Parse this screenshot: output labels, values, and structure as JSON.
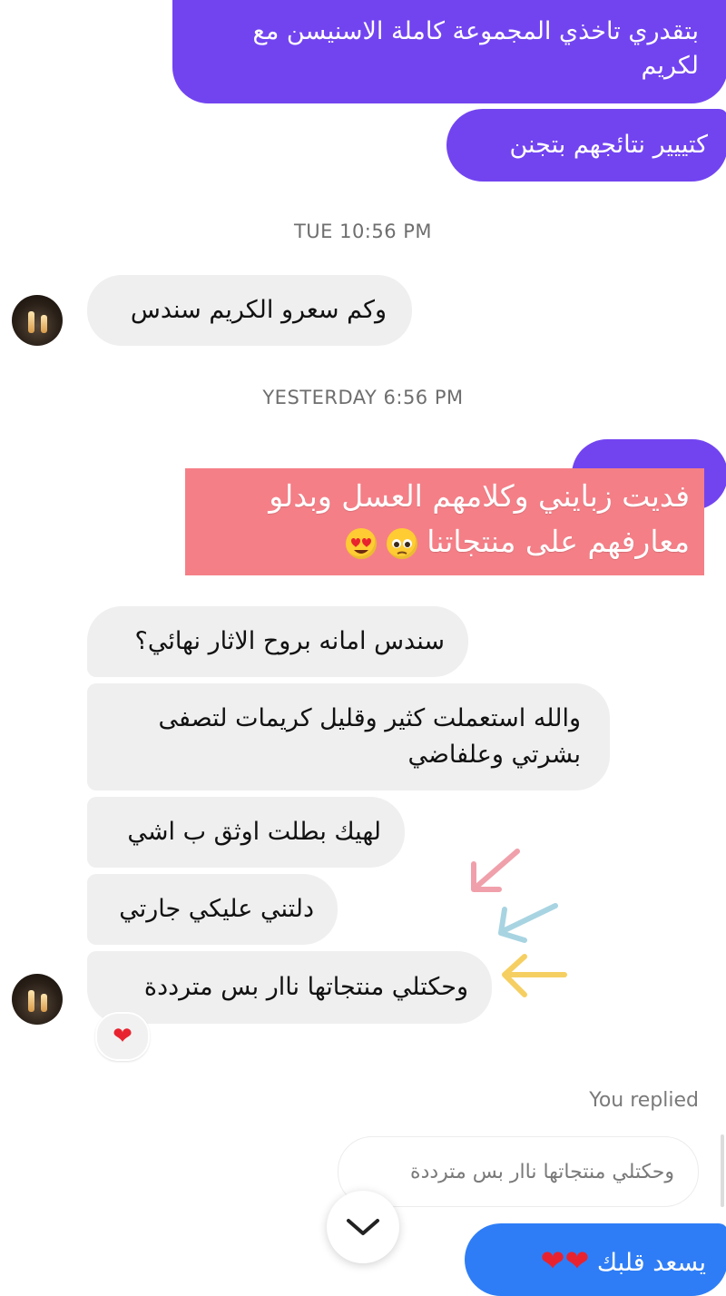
{
  "colors": {
    "outgoing_purple": "#7244f0",
    "outgoing_blue": "#2e7df6",
    "incoming_gray": "#efefef",
    "overlay_pink": "#f57f87"
  },
  "messages_top": {
    "msg1_line1": "بتقدري تاخذي المجموعة كاملة الاسنيسن مع",
    "msg1_line2": "لكريم",
    "msg2": "كتييير نتائجهم بتجنن"
  },
  "timestamp1": "TUE 10:56 PM",
  "incoming1": "وكم سعرو الكريم سندس",
  "timestamp2": "YESTERDAY 6:56 PM",
  "overlay": {
    "line1": "فديت زبايني وكلامهم العسل وبدلو",
    "line2": "معارفهم على منتجاتنا",
    "emoji_names": [
      "pleading-face-icon",
      "heart-eyes-icon"
    ]
  },
  "incoming_group": {
    "m1": "سندس امانه بروح الاثار نهائي؟",
    "m2_line1": "والله استعملت كثير وقليل كريمات لتصفى",
    "m2_line2": "بشرتي وعلفاضي",
    "m3": "لهيك بطلت اوثق ب اشي",
    "m4": "دلتني عليكي جارتي",
    "m5": "وحكتلي منتجاتها ناار بس مترددة"
  },
  "reaction_icon": "heart-icon",
  "you_replied": "You replied",
  "reply_preview": "وحكتلي منتجاتها ناار بس مترددة",
  "last_message": "يسعد قلبك",
  "scroll_icon": "chevron-down-icon"
}
